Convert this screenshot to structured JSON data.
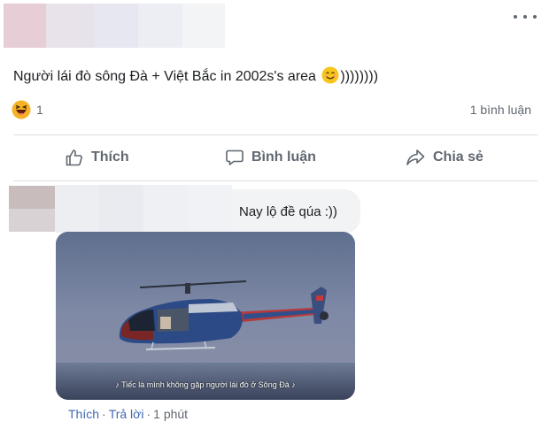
{
  "post": {
    "text_before_emoji": "Người lái đò sông Đà + Việt Bắc in 2002s's area ",
    "text_after_emoji": "))))))))",
    "emoji": "smile-emoji",
    "reaction_icon": "haha-icon",
    "reaction_count": "1",
    "comment_count": "1 bình luận"
  },
  "actions": {
    "like_label": "Thích",
    "comment_label": "Bình luận",
    "share_label": "Chia sẻ"
  },
  "comment": {
    "text": "Nay lộ đề qúa :))",
    "video_subtitle": "♪ Tiếc là mình không gặp người lái đò ở Sông Đà ♪",
    "like_label": "Thích",
    "reply_label": "Trả lời",
    "time": "1 phút"
  },
  "colors": {
    "link": "#4267b2",
    "secondary_text": "#606770",
    "divider": "#dadde1",
    "bubble": "#f2f3f5"
  }
}
